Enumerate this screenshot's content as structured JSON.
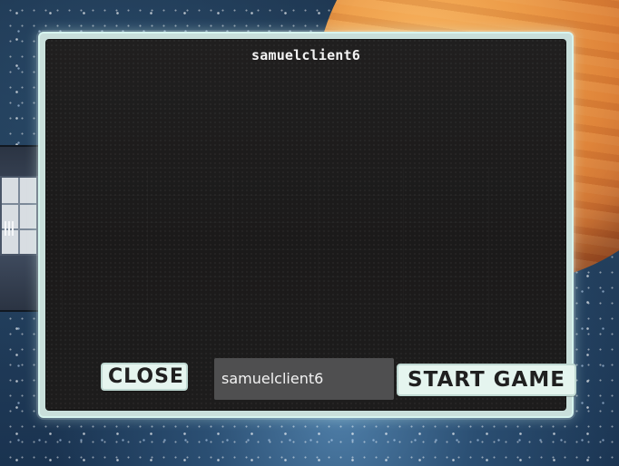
{
  "dialog": {
    "title": "samuelclient6",
    "close_label": "CLOSE",
    "player_name_value": "samuelclient6",
    "start_label": "START GAME"
  },
  "icons": {
    "ship": "spaceship-icon",
    "planet": "planet-icon"
  },
  "colors": {
    "panel_background": "#1d1c1c",
    "frame_border": "#d6f4ee",
    "button_background": "#e5f5ef",
    "input_background": "#4f4f50",
    "planet_accent": "#dc7f35"
  }
}
